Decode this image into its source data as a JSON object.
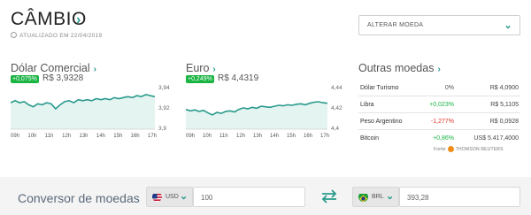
{
  "header": {
    "title": "CÂMBIO",
    "updated": "ATUALIZADO EM 22/04/2019",
    "select_label": "ALTERAR MOEDA"
  },
  "dolar": {
    "title": "Dólar Comercial",
    "change": "+0,075%",
    "price": "R$ 3,9328",
    "chart_data": {
      "type": "line",
      "x": [
        "09h",
        "10h",
        "11h",
        "12h",
        "13h",
        "14h",
        "15h",
        "16h",
        "17h"
      ],
      "y_ticks": [
        "3,94",
        "3,92",
        "3,9"
      ],
      "ylim": [
        3.9,
        3.94
      ],
      "points": [
        3.926,
        3.928,
        3.926,
        3.927,
        3.924,
        3.922,
        3.925,
        3.924,
        3.926,
        3.925,
        3.92,
        3.924,
        3.927,
        3.928,
        3.926,
        3.929,
        3.928,
        3.929,
        3.928,
        3.93,
        3.929,
        3.93,
        3.929,
        3.931,
        3.93,
        3.931,
        3.932,
        3.931,
        3.933,
        3.932,
        3.934,
        3.933,
        3.932
      ]
    }
  },
  "euro": {
    "title": "Euro",
    "change": "+0,249%",
    "price": "R$ 4,4319",
    "chart_data": {
      "type": "line",
      "x": [
        "09h",
        "10h",
        "11h",
        "12h",
        "13h",
        "14h",
        "15h",
        "16h",
        "17h"
      ],
      "y_ticks": [
        "4,44",
        "4,42",
        "4,4"
      ],
      "ylim": [
        4.4,
        4.44
      ],
      "points": [
        4.4195,
        4.418,
        4.419,
        4.4175,
        4.4185,
        4.416,
        4.414,
        4.4165,
        4.4155,
        4.4175,
        4.418,
        4.417,
        4.4195,
        4.421,
        4.42,
        4.4215,
        4.4205,
        4.4225,
        4.422,
        4.4215,
        4.4225,
        4.4235,
        4.423,
        4.424,
        4.4235,
        4.4245,
        4.425,
        4.424,
        4.4255,
        4.4265,
        4.427,
        4.426,
        4.4255
      ]
    }
  },
  "outras": {
    "title": "Outras moedas",
    "rows": [
      {
        "name": "Dólar Turismo",
        "change": "0%",
        "value": "R$ 4,0900",
        "color": "#555555"
      },
      {
        "name": "Libra",
        "change": "+0,023%",
        "value": "R$ 5,1105",
        "color": "#19b441"
      },
      {
        "name": "Peso Argentino",
        "change": "-1,277%",
        "value": "R$ 0,0928",
        "color": "#e0342b"
      },
      {
        "name": "Bitcoin",
        "change": "+0,86%",
        "value": "US$ 5.417,4000",
        "color": "#19b441"
      }
    ],
    "fonte_label": "Fonte",
    "fonte_source": "THOMSON REUTERS"
  },
  "converter": {
    "title": "Conversor de moedas",
    "from_code": "USD",
    "from_amount": "100",
    "to_code": "BRL",
    "to_amount": "393,28"
  },
  "colors": {
    "accent": "#2a9a8c",
    "positive": "#19b441",
    "negative": "#e0342b",
    "chart_fill": "#e3f4f1"
  }
}
